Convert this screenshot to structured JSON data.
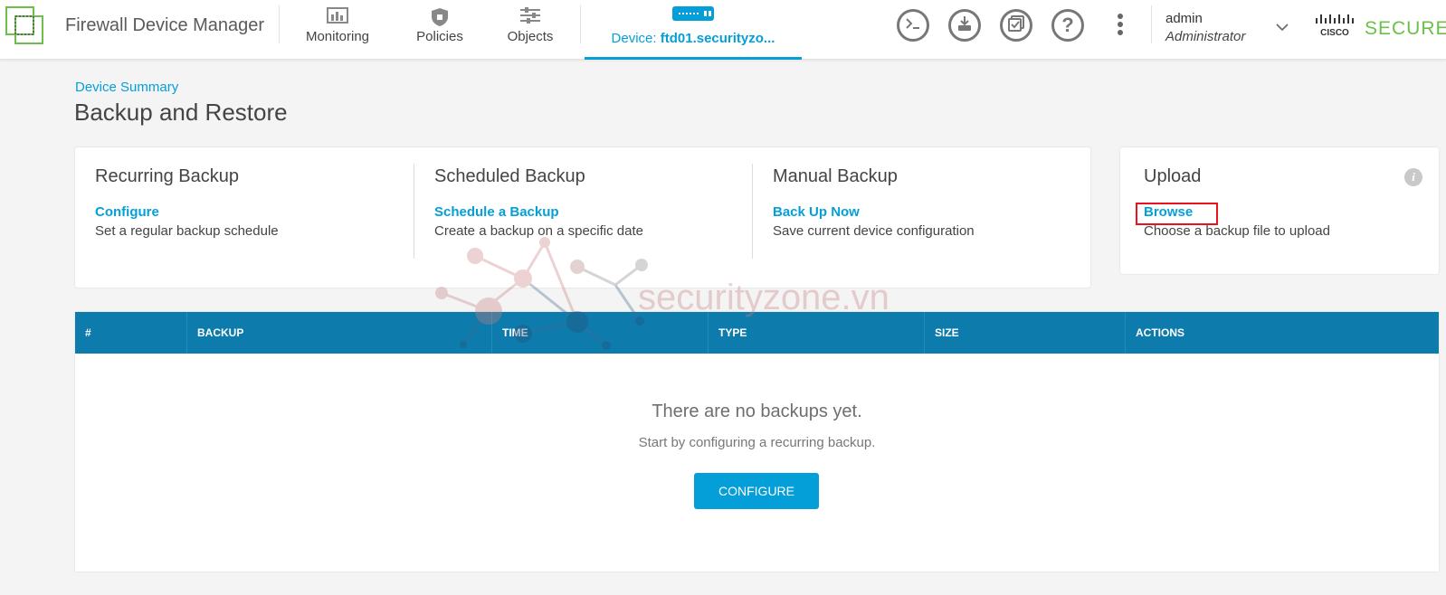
{
  "header": {
    "app_title": "Firewall Device Manager",
    "nav": [
      {
        "label": "Monitoring",
        "icon": "monitoring-icon"
      },
      {
        "label": "Policies",
        "icon": "policies-icon"
      },
      {
        "label": "Objects",
        "icon": "objects-icon"
      }
    ],
    "device": {
      "prefix": "Device: ",
      "name": "ftd01.securityzo..."
    },
    "actions": [
      "cli-console-icon",
      "deploy-icon",
      "task-list-icon",
      "help-icon",
      "more-options-icon"
    ],
    "user": {
      "name": "admin",
      "role": "Administrator"
    },
    "brand": {
      "cisco": "CISCO",
      "word": "SECURE"
    }
  },
  "breadcrumb": "Device Summary",
  "page_title": "Backup and Restore",
  "cards": {
    "recurring": {
      "title": "Recurring Backup",
      "link": "Configure",
      "desc": "Set a regular backup schedule"
    },
    "scheduled": {
      "title": "Scheduled Backup",
      "link": "Schedule a Backup",
      "desc": "Create a backup on a specific date"
    },
    "manual": {
      "title": "Manual Backup",
      "link": "Back Up Now",
      "desc": "Save current device configuration"
    },
    "upload": {
      "title": "Upload",
      "link": "Browse",
      "desc": "Choose a backup file to upload",
      "info": "i"
    }
  },
  "table": {
    "columns": [
      "#",
      "BACKUP",
      "TIME",
      "TYPE",
      "SIZE",
      "ACTIONS"
    ],
    "rows": [],
    "empty_title": "There are no backups yet.",
    "empty_subtitle": "Start by configuring a recurring backup.",
    "configure_button": "CONFIGURE"
  },
  "watermark": "securityzone.vn",
  "colors": {
    "accent": "#049fd9",
    "table_header": "#0d7bac",
    "brand_green": "#6cc04a",
    "highlight": "#e8131e"
  }
}
